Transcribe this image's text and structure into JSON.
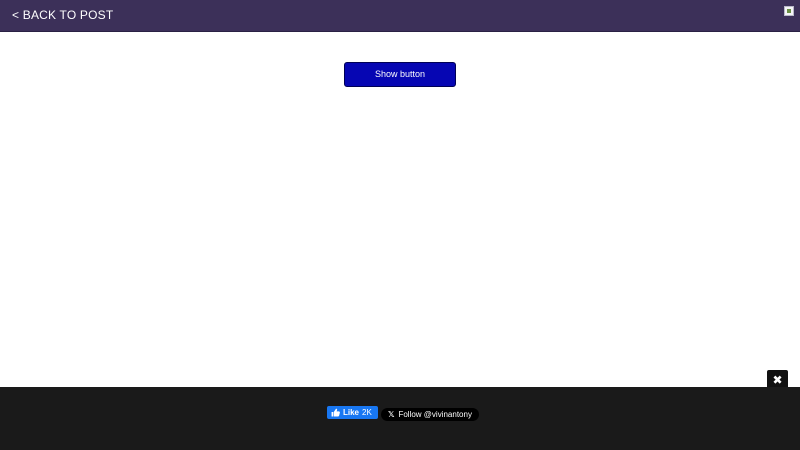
{
  "header": {
    "back_label": "< BACK TO POST",
    "background_color": "#3c3059",
    "corner_image_icon": "broken-image-icon"
  },
  "main": {
    "show_button_label": "Show button",
    "show_button_color": "#0606b3"
  },
  "footer": {
    "background_color": "#1a1a1a",
    "close_label": "✖",
    "facebook": {
      "label": "Like",
      "count": "2K",
      "icon": "thumbs-up-icon",
      "color": "#1877f2"
    },
    "twitter": {
      "icon_glyph": "𝕏",
      "label": "Follow @vivinantony",
      "icon": "x-logo-icon"
    }
  }
}
